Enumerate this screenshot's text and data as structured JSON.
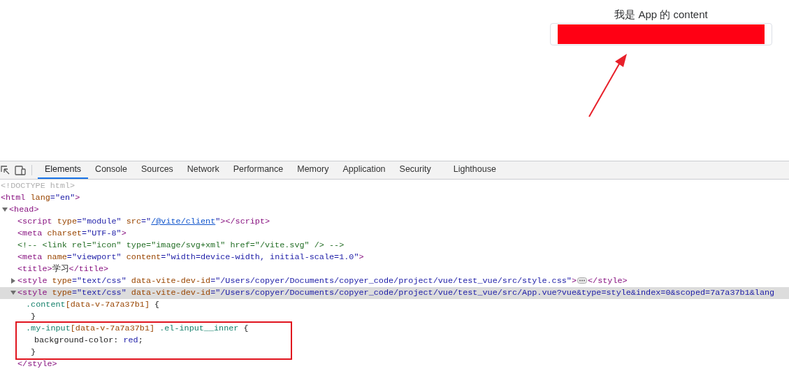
{
  "page": {
    "content_text": "我是 App 的 content"
  },
  "devtools": {
    "tabs": [
      {
        "label": "Elements",
        "selected": true
      },
      {
        "label": "Console",
        "selected": false
      },
      {
        "label": "Sources",
        "selected": false
      },
      {
        "label": "Network",
        "selected": false
      },
      {
        "label": "Performance",
        "selected": false
      },
      {
        "label": "Memory",
        "selected": false
      },
      {
        "label": "Application",
        "selected": false
      },
      {
        "label": "Security",
        "selected": false
      },
      {
        "label": "Lighthouse",
        "selected": false
      }
    ],
    "dom_tree": [
      {
        "selected": false,
        "tokens": [
          {
            "kind": "doctype",
            "text": "<!DOCTYPE html>"
          }
        ]
      },
      {
        "selected": false,
        "tokens": [
          {
            "kind": "tag",
            "text": "<html"
          },
          {
            "kind": "attr",
            "text": " lang"
          },
          {
            "kind": "value",
            "text": "=\"en\""
          },
          {
            "kind": "tag",
            "text": ">"
          }
        ],
        "children": [
          {
            "selected": false,
            "expanded": true,
            "tokens": [
              {
                "kind": "tag",
                "text": "<head>"
              }
            ],
            "children": [
              {
                "selected": false,
                "tokens": [
                  {
                    "kind": "tag",
                    "text": "<script"
                  },
                  {
                    "kind": "attr",
                    "text": " type"
                  },
                  {
                    "kind": "value",
                    "text": "=\"module\""
                  },
                  {
                    "kind": "attr",
                    "text": " src"
                  },
                  {
                    "kind": "value",
                    "text": "=\""
                  },
                  {
                    "kind": "link",
                    "text": "/@vite/client"
                  },
                  {
                    "kind": "value",
                    "text": "\""
                  },
                  {
                    "kind": "tag",
                    "text": "></script>"
                  }
                ]
              },
              {
                "selected": false,
                "tokens": [
                  {
                    "kind": "tag",
                    "text": "<meta"
                  },
                  {
                    "kind": "attr",
                    "text": " charset"
                  },
                  {
                    "kind": "value",
                    "text": "=\"UTF-8\""
                  },
                  {
                    "kind": "tag",
                    "text": ">"
                  }
                ]
              },
              {
                "selected": false,
                "tokens": [
                  {
                    "kind": "comment",
                    "text": "<!-- <link rel=\"icon\" type=\"image/svg+xml\" href=\"/vite.svg\" /> -->"
                  }
                ]
              },
              {
                "selected": false,
                "tokens": [
                  {
                    "kind": "tag",
                    "text": "<meta"
                  },
                  {
                    "kind": "attr",
                    "text": " name"
                  },
                  {
                    "kind": "value",
                    "text": "=\"viewport\""
                  },
                  {
                    "kind": "attr",
                    "text": " content"
                  },
                  {
                    "kind": "value",
                    "text": "=\"width=device-width, initial-scale=1.0\""
                  },
                  {
                    "kind": "tag",
                    "text": ">"
                  }
                ]
              },
              {
                "selected": false,
                "tokens": [
                  {
                    "kind": "tag",
                    "text": "<title>"
                  },
                  {
                    "kind": "text",
                    "text": "学习"
                  },
                  {
                    "kind": "tag",
                    "text": "</title>"
                  }
                ]
              },
              {
                "selected": false,
                "expanded": false,
                "tokens": [
                  {
                    "kind": "tag",
                    "text": "<style"
                  },
                  {
                    "kind": "attr",
                    "text": " type"
                  },
                  {
                    "kind": "value",
                    "text": "=\"text/css\""
                  },
                  {
                    "kind": "attr",
                    "text": " data-vite-dev-id"
                  },
                  {
                    "kind": "value",
                    "text": "=\"/Users/copyer/Documents/copyer_code/project/vue/test_vue/src/style.css\""
                  },
                  {
                    "kind": "tag",
                    "text": ">"
                  }
                ],
                "closing": [
                  {
                    "kind": "tag",
                    "text": "</style>"
                  }
                ]
              },
              {
                "selected": true,
                "expanded": true,
                "tokens": [
                  {
                    "kind": "tag",
                    "text": "<style"
                  },
                  {
                    "kind": "attr",
                    "text": " type"
                  },
                  {
                    "kind": "value",
                    "text": "=\"text/css\""
                  },
                  {
                    "kind": "attr",
                    "text": " data-vite-dev-id"
                  },
                  {
                    "kind": "value",
                    "text": "=\"/Users/copyer/Documents/copyer_code/project/vue/test_vue/src/App.vue?vue&type=style&index=0&scoped=7a7a37b1&lang"
                  }
                ],
                "closing": [
                  {
                    "kind": "tag",
                    "text": "</style>"
                  }
                ],
                "children": [
                  {
                    "selected": false,
                    "tokens": [
                      {
                        "kind": "selector",
                        "text": ".content"
                      },
                      {
                        "kind": "attr",
                        "text": "[data-v-7a7a37b1]"
                      },
                      {
                        "kind": "text",
                        "text": " {"
                      }
                    ],
                    "closing": [
                      {
                        "kind": "brace",
                        "text": "}"
                      }
                    ]
                  },
                  {
                    "selected": false,
                    "annotated": true,
                    "tokens": [
                      {
                        "kind": "selector",
                        "text": ".my-input"
                      },
                      {
                        "kind": "attr",
                        "text": "[data-v-7a7a37b1]"
                      },
                      {
                        "kind": "selector",
                        "text": " .el-input__inner"
                      },
                      {
                        "kind": "text",
                        "text": " {"
                      }
                    ],
                    "closing": [
                      {
                        "kind": "brace",
                        "text": "}"
                      }
                    ],
                    "children": [
                      {
                        "selected": false,
                        "tokens": [
                          {
                            "kind": "text",
                            "text": "background-color: "
                          },
                          {
                            "kind": "value",
                            "text": "red"
                          },
                          {
                            "kind": "text",
                            "text": ";"
                          }
                        ]
                      }
                    ]
                  }
                ]
              }
            ]
          }
        ]
      }
    ]
  }
}
